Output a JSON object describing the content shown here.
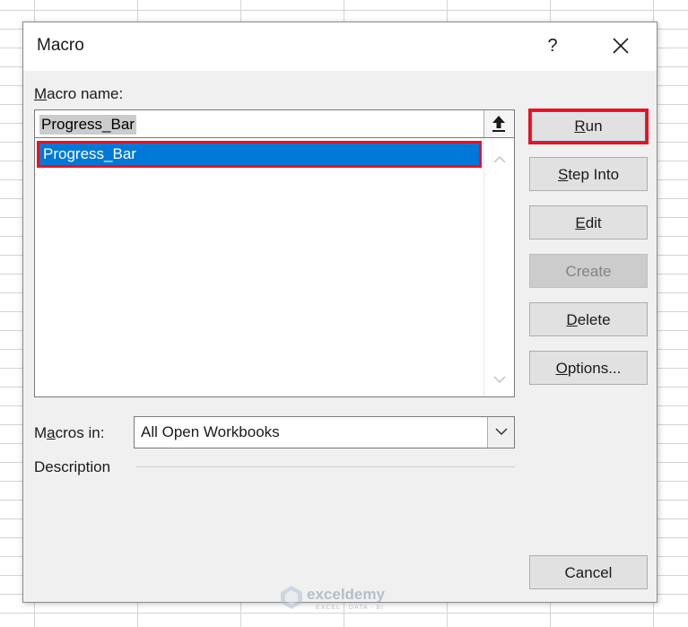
{
  "dialog": {
    "title": "Macro",
    "help_label": "?"
  },
  "macro_name": {
    "label_mnemonic": "M",
    "label_rest": "acro name:",
    "input_value": "Progress_Bar"
  },
  "macro_list": {
    "items": [
      "Progress_Bar"
    ],
    "selected_index": 0
  },
  "buttons": {
    "run": {
      "mnemonic": "R",
      "rest": "un",
      "enabled": true
    },
    "step_into": {
      "mnemonic": "S",
      "rest": "tep Into",
      "enabled": true
    },
    "edit": {
      "mnemonic": "E",
      "rest": "dit",
      "enabled": true
    },
    "create": {
      "label": "Create",
      "enabled": false
    },
    "delete": {
      "mnemonic": "D",
      "rest": "elete",
      "enabled": true
    },
    "options": {
      "mnemonic": "O",
      "rest": "ptions...",
      "enabled": true
    },
    "cancel": {
      "label": "Cancel",
      "enabled": true
    }
  },
  "macros_in": {
    "label_pre": "M",
    "label_mnemonic": "a",
    "label_rest": "cros in:",
    "selected": "All Open Workbooks"
  },
  "description": {
    "label": "Description"
  },
  "watermark": {
    "name": "exceldemy",
    "tagline": "EXCEL · DATA · BI"
  },
  "colors": {
    "selection": "#0078d7",
    "highlight_border": "#e81123",
    "dialog_bg": "#f0f0f0"
  }
}
